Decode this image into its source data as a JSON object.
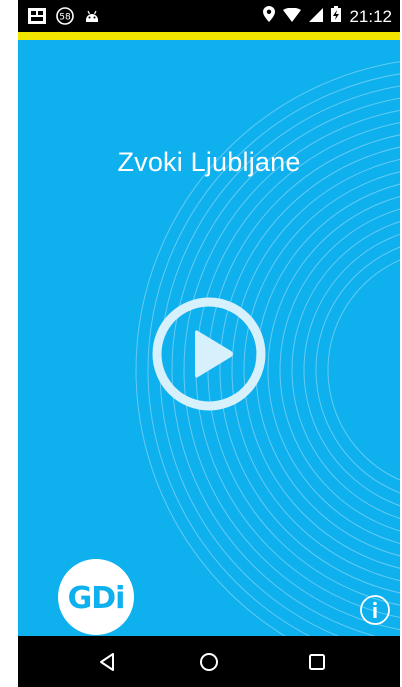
{
  "status_bar": {
    "notification_badge": "58",
    "time": "21:12",
    "icons": [
      "gallery-icon",
      "notification-count-icon",
      "android-icon",
      "location-icon",
      "wifi-icon",
      "signal-icon",
      "battery-icon"
    ]
  },
  "app": {
    "title": "Zvoki Ljubljane",
    "background_color": "#0fb0ee",
    "accent_color": "#f2e600",
    "play_icon": "play-icon",
    "logo_text": "GDi",
    "info_icon": "info-icon"
  },
  "nav_bar": {
    "icons": [
      "back-icon",
      "home-icon",
      "recents-icon"
    ]
  }
}
